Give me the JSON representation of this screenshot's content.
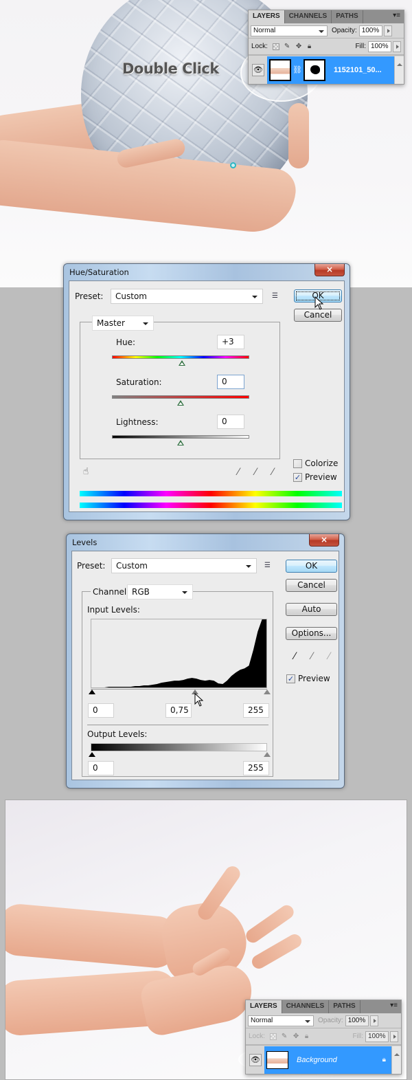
{
  "top_photo": {
    "annotation": "Double Click",
    "description": "hands holding puzzle globe"
  },
  "layers_panel_top": {
    "tabs": [
      "LAYERS",
      "CHANNELS",
      "PATHS"
    ],
    "active_tab": "LAYERS",
    "blend_mode": "Normal",
    "opacity_label": "Opacity:",
    "opacity": "100%",
    "lock_label": "Lock:",
    "fill_label": "Fill:",
    "fill": "100%",
    "layer_name": "1152101_50...",
    "layer_selected": true
  },
  "hue_saturation": {
    "title": "Hue/Saturation",
    "close_icon": "×",
    "preset_label": "Preset:",
    "preset_value": "Custom",
    "ok_label": "OK",
    "cancel_label": "Cancel",
    "range_value": "Master",
    "hue_label": "Hue:",
    "hue_value": "+3",
    "hue_position": 0.51,
    "saturation_label": "Saturation:",
    "saturation_value": "0",
    "saturation_position": 0.5,
    "lightness_label": "Lightness:",
    "lightness_value": "0",
    "lightness_position": 0.5,
    "colorize_label": "Colorize",
    "colorize_checked": false,
    "preview_label": "Preview",
    "preview_checked": true
  },
  "levels": {
    "title": "Levels",
    "close_icon": "×",
    "preset_label": "Preset:",
    "preset_value": "Custom",
    "channel_label": "Channel:",
    "channel_value": "RGB",
    "input_levels_label": "Input Levels:",
    "input_black": "0",
    "input_gamma": "0,75",
    "input_white": "255",
    "output_levels_label": "Output Levels:",
    "output_black": "0",
    "output_white": "255",
    "ok_label": "OK",
    "cancel_label": "Cancel",
    "auto_label": "Auto",
    "options_label": "Options...",
    "preview_label": "Preview",
    "preview_checked": true,
    "histogram_relative": [
      0,
      0,
      0,
      0,
      0.01,
      0.01,
      0.01,
      0.01,
      0.01,
      0.01,
      0.02,
      0.02,
      0.03,
      0.03,
      0.04,
      0.05,
      0.07,
      0.08,
      0.09,
      0.1,
      0.1,
      0.11,
      0.13,
      0.14,
      0.13,
      0.11,
      0.1,
      0.11,
      0.1,
      0.06,
      0.05,
      0.1,
      0.17,
      0.22,
      0.26,
      0.28,
      0.32,
      0.55,
      0.82,
      1.0,
      1.0
    ]
  },
  "layers_panel_bottom": {
    "tabs": [
      "LAYERS",
      "CHANNELS",
      "PATHS"
    ],
    "active_tab": "LAYERS",
    "blend_mode": "Normal",
    "opacity_label": "Opacity:",
    "opacity": "100%",
    "lock_label": "Lock:",
    "fill_label": "Fill:",
    "fill": "100%",
    "layer_name": "Background",
    "layer_locked": true,
    "layer_selected": true
  }
}
